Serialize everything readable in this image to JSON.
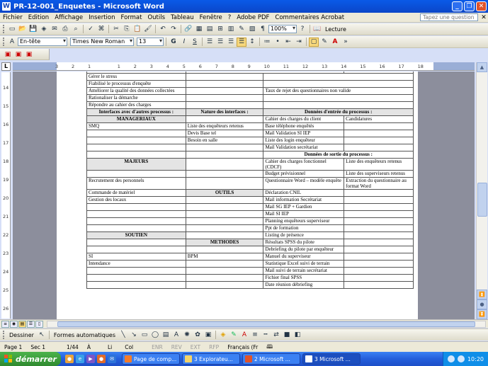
{
  "window": {
    "title": "PR-12-001_Enquetes - Microsoft Word"
  },
  "menu": {
    "items": [
      "Fichier",
      "Edition",
      "Affichage",
      "Insertion",
      "Format",
      "Outils",
      "Tableau",
      "Fenêtre",
      "?",
      "Adobe PDF",
      "Commentaires Acrobat"
    ],
    "help_placeholder": "Tapez une question"
  },
  "toolbar": {
    "zoom": "100%",
    "reading_label": "Lecture"
  },
  "format_toolbar": {
    "style": "En-tête",
    "font": "Times New Roman",
    "size": "13",
    "bold": "G",
    "italic": "I",
    "underline": "S"
  },
  "ruler": {
    "h_ticks": [
      "3",
      "2",
      "1",
      "",
      "1",
      "2",
      "3",
      "4",
      "5",
      "6",
      "7",
      "8",
      "9",
      "10",
      "11",
      "12",
      "13",
      "14",
      "15",
      "16",
      "17",
      "18"
    ],
    "v_ticks": [
      "14",
      "15",
      "16",
      "17",
      "18",
      "19",
      "20",
      "21",
      "22",
      "23",
      "24",
      "25",
      "26"
    ]
  },
  "table": {
    "top_rows": [
      [
        "Gérer le stress",
        "",
        ""
      ],
      [
        "Fiabilisé le processus d'enquête",
        "",
        ""
      ],
      [
        "Améliorer la qualité des données collectées",
        "",
        "Taux de rejet des questionnaires non valide"
      ],
      [
        "Rationaliser la démarche",
        "",
        ""
      ],
      [
        "Répondre au cahier des charges",
        "",
        ""
      ]
    ],
    "headers": {
      "interfaces": "Interfaces avec d'autres processus :",
      "nature": "Nature des interfaces :",
      "inputs": "Données d'entrée du processus :",
      "outputs": "Données de sortie du processus :"
    },
    "sections": {
      "manageriaux": "MANAGERIAUX",
      "majeurs": "MAJEURS",
      "soutien": "SOUTIEN",
      "outils": "OUTILS",
      "methodes": "METHODES"
    },
    "rows": [
      [
        "",
        "",
        "Cahier des charges du client",
        "Candidatures"
      ],
      [
        "SMQ",
        "Liste des enquêteurs retenus",
        "Base téléphone enquêtés",
        ""
      ],
      [
        "",
        "Devis Base tel",
        "Mail Validation SI IEP",
        ""
      ],
      [
        "",
        "Besoin en salle",
        "Liste des login enquêteur",
        ""
      ],
      [
        "",
        "",
        "Mail Validation secrétariat",
        ""
      ],
      [
        "",
        "",
        "Cahier des charges fonctionnel (CDCF)",
        "Liste des enquêteurs retenus"
      ],
      [
        "",
        "",
        "Budget prévisionnel",
        "Liste des superviseurs retenus"
      ],
      [
        "Recrutement des personnels",
        "",
        "Questionnaire Word – modèle enquête",
        "Extraction du questionnaire au format  Word"
      ],
      [
        "Commande de matériel",
        "",
        "Déclaration CNIL",
        ""
      ],
      [
        "Gestion des locaux",
        "",
        "Mail information Secrétariat",
        ""
      ],
      [
        "",
        "",
        "Mail SG IEP + Gardien",
        ""
      ],
      [
        "",
        "",
        "Mail SI IEP",
        ""
      ],
      [
        "",
        "",
        "Planning enquêteurs superviseur",
        ""
      ],
      [
        "",
        "",
        "Ppt de formation",
        ""
      ],
      [
        "",
        "",
        "Listing de présence",
        ""
      ],
      [
        "",
        "",
        "Résultats SPSS du pilote",
        ""
      ],
      [
        "",
        "",
        "Debriefing du pilote par enquêteur",
        ""
      ],
      [
        "SI",
        "BPM",
        "Manuel du superviseur",
        ""
      ],
      [
        "Intendance",
        "",
        "Statistique Excel suivi de terrain",
        ""
      ],
      [
        "",
        "",
        "Mail suivi de terrain secrétariat",
        ""
      ],
      [
        "",
        "",
        "Fichier final SPSS",
        ""
      ],
      [
        "",
        "",
        "Date réunion débriefing",
        ""
      ]
    ]
  },
  "drawing": {
    "draw_label": "Dessiner",
    "shapes_label": "Formes automatiques"
  },
  "status": {
    "page": "Page  1",
    "section": "Sec  1",
    "pages": "1/44",
    "at": "À",
    "line": "Li",
    "col": "Col",
    "enr": "ENR",
    "rev": "REV",
    "ext": "EXT",
    "rfp": "RFP",
    "lang": "Français (Fr"
  },
  "taskbar": {
    "start": "démarrer",
    "tasks": [
      "Page de comp...",
      "3 Explorateu...",
      "2 Microsoft ...",
      "3 Microsoft ..."
    ],
    "clock": "10:20"
  }
}
